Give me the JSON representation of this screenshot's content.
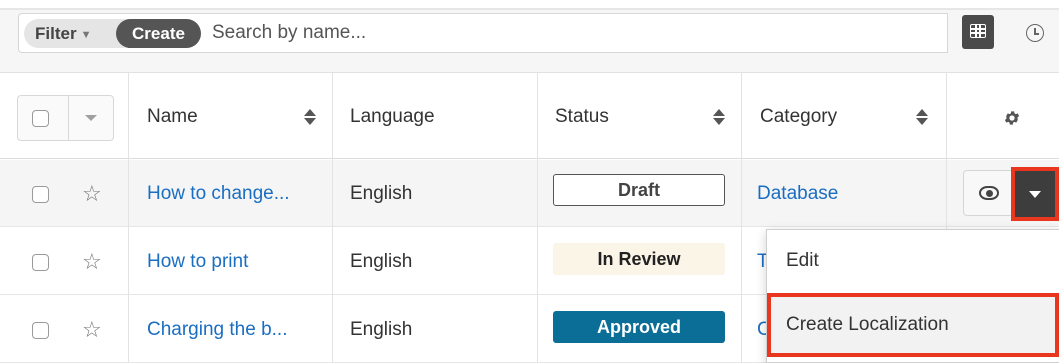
{
  "filterbar": {
    "filter_label": "Filter",
    "create_label": "Create",
    "search_placeholder": "Search by name..."
  },
  "table": {
    "columns": {
      "name": "Name",
      "language": "Language",
      "status": "Status",
      "category": "Category"
    },
    "rows": [
      {
        "name": "How to change...",
        "language": "English",
        "status": "Draft",
        "category": "Database"
      },
      {
        "name": "How to print",
        "language": "English",
        "status": "In Review",
        "category": "T"
      },
      {
        "name": "Charging the b...",
        "language": "English",
        "status": "Approved",
        "category": "C"
      }
    ]
  },
  "actions_menu": {
    "items": [
      "Edit",
      "Create Localization"
    ]
  },
  "colors": {
    "link": "#1a6ec2",
    "approved": "#0a6e96",
    "in_review_bg": "#fbf5e7",
    "highlight": "#e8361f"
  },
  "icons": [
    "chevron-down-icon",
    "list-view-icon",
    "clock-icon",
    "gear-icon",
    "star-icon",
    "eye-icon",
    "caret-down-icon",
    "sort-icon"
  ]
}
